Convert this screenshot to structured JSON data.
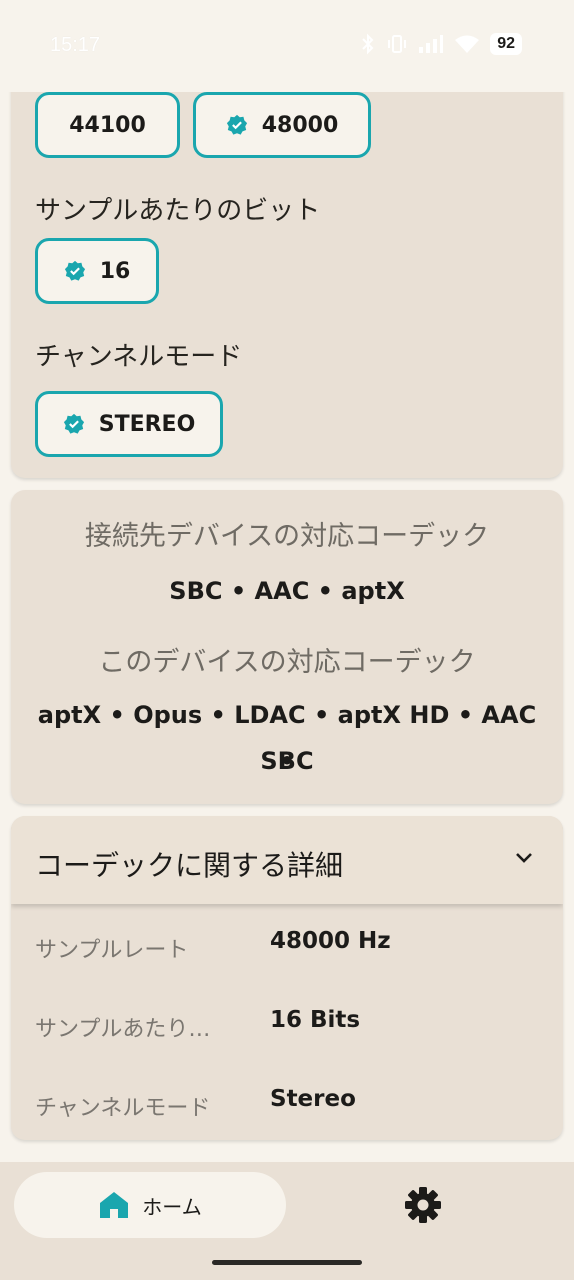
{
  "status_bar": {
    "time": "15:17",
    "battery": "92"
  },
  "sample_rate_options": [
    "44100",
    "48000"
  ],
  "bits_section": {
    "label": "サンプルあたりのビット",
    "options": [
      "16"
    ]
  },
  "channel_section": {
    "label": "チャンネルモード",
    "options": [
      "STEREO"
    ]
  },
  "codecs": {
    "remote_heading": "接続先デバイスの対応コーデック",
    "remote_list": "SBC • AAC • aptX",
    "local_heading": "このデバイスの対応コーデック",
    "local_list_line1": "aptX • Opus • LDAC • aptX HD • AAC •",
    "local_list_line2": "SBC"
  },
  "details": {
    "title": "コーデックに関する詳細",
    "rows": [
      {
        "key": "サンプルレート",
        "value": "48000 Hz"
      },
      {
        "key": "サンプルあたり…",
        "value": "16 Bits"
      },
      {
        "key": "チャンネルモード",
        "value": "Stereo"
      }
    ]
  },
  "nav": {
    "home_label": "ホーム"
  },
  "colors": {
    "accent": "#1aa6ae",
    "card": "#e9e0d5",
    "background": "#f7f3ec"
  },
  "icons": [
    "bluetooth-icon",
    "vibrate-icon",
    "signal-icon",
    "wifi-icon",
    "verified-check-icon",
    "chevron-down-icon",
    "home-icon",
    "gear-icon"
  ]
}
